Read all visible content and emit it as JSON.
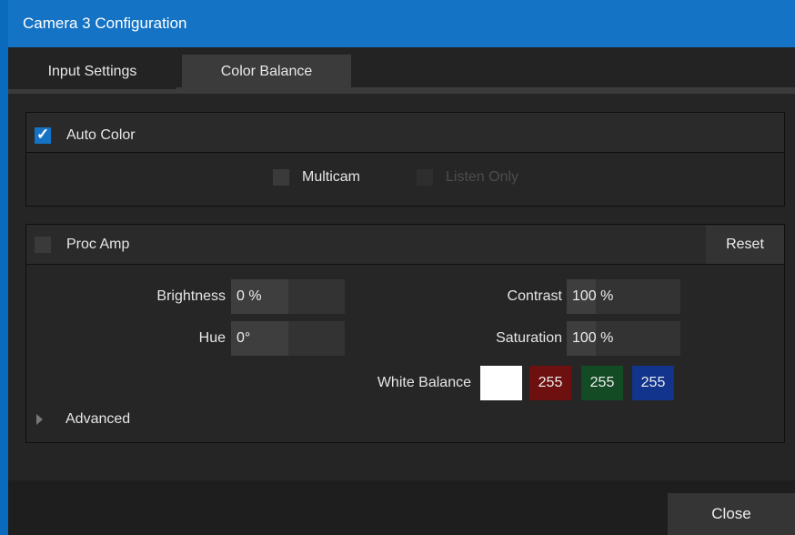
{
  "window": {
    "title": "Camera 3 Configuration"
  },
  "tabs": [
    {
      "label": "Input Settings",
      "active": false
    },
    {
      "label": "Color Balance",
      "active": true
    }
  ],
  "auto_color": {
    "label": "Auto Color",
    "checked": true,
    "multicam_label": "Multicam",
    "multicam_checked": false,
    "listen_only_label": "Listen Only",
    "listen_only_enabled": false
  },
  "proc_amp": {
    "label": "Proc Amp",
    "checked": false,
    "reset_label": "Reset",
    "brightness": {
      "label": "Brightness",
      "value": "0 %",
      "fill_fraction": 0.5
    },
    "hue": {
      "label": "Hue",
      "value": "0°",
      "fill_fraction": 0.5
    },
    "contrast": {
      "label": "Contrast",
      "value": "100 %",
      "fill_fraction": 0.25
    },
    "saturation": {
      "label": "Saturation",
      "value": "100 %",
      "fill_fraction": 0.25
    },
    "white_balance": {
      "label": "White Balance",
      "swatch_color": "#ffffff",
      "r": "255",
      "g": "255",
      "b": "255"
    },
    "advanced_label": "Advanced"
  },
  "footer": {
    "close_label": "Close"
  },
  "colors": {
    "accent": "#1473c4",
    "red_channel": "#6e1010",
    "green_channel": "#134b24",
    "blue_channel": "#12348c"
  }
}
